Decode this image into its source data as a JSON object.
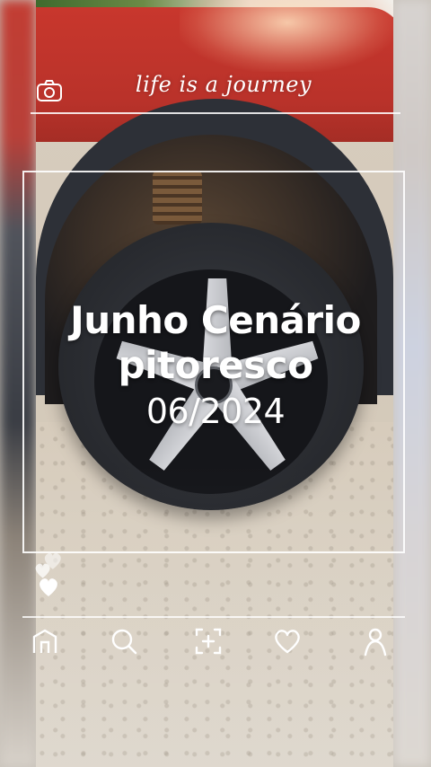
{
  "header": {
    "title": "life is a journey",
    "camera_icon": "camera-icon"
  },
  "card": {
    "headline_line1": "Junho Cenário",
    "headline_line2": "pitoresco",
    "date": "06/2024"
  },
  "reactions": {
    "icon": "heart-icon"
  },
  "bottom_nav": {
    "items": [
      {
        "icon": "home-icon"
      },
      {
        "icon": "search-icon"
      },
      {
        "icon": "add-icon"
      },
      {
        "icon": "heart-outline-icon"
      },
      {
        "icon": "profile-icon"
      }
    ]
  },
  "colors": {
    "overlay_text": "#ffffff",
    "car_red": "#c8372d",
    "tire_dark": "#2a2c31"
  }
}
